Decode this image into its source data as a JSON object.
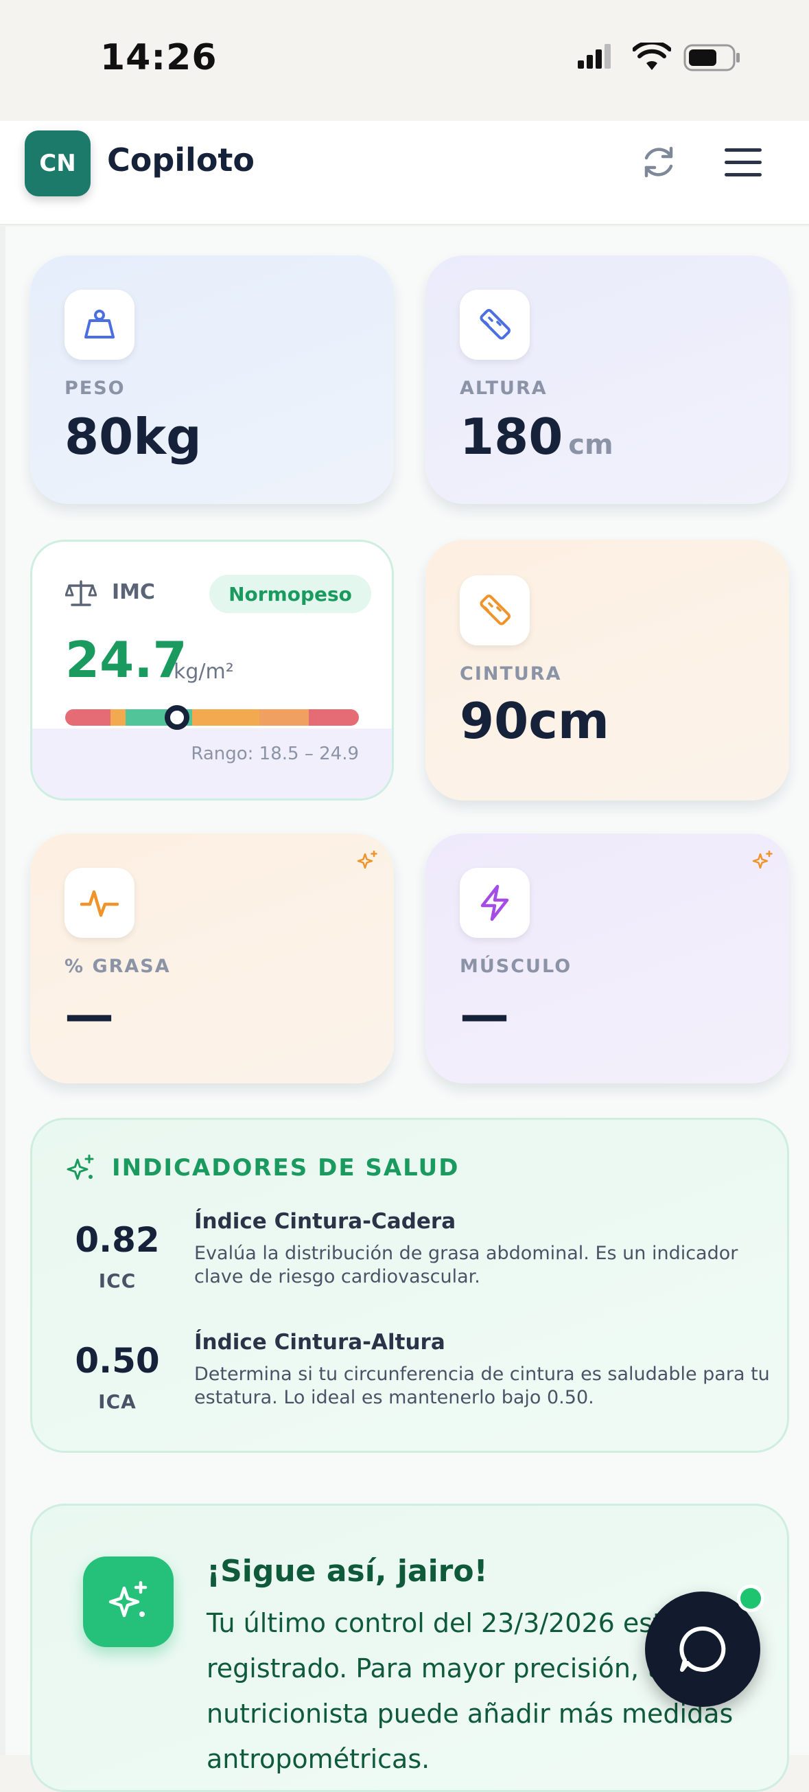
{
  "status_bar": {
    "time": "14:26"
  },
  "header": {
    "avatar_initials": "CN",
    "title": "Copiloto"
  },
  "metrics": {
    "peso": {
      "label": "PESO",
      "value": "80kg"
    },
    "altura": {
      "label": "ALTURA",
      "value": "180",
      "unit": "cm"
    },
    "imc": {
      "label": "IMC",
      "badge": "Normopeso",
      "value": "24.7",
      "unit": "kg/m²",
      "range": "Rango: 18.5 – 24.9",
      "marker_fraction": 0.38
    },
    "cintura": {
      "label": "CINTURA",
      "value": "90cm"
    },
    "grasa": {
      "label": "% GRASA",
      "value": "—"
    },
    "musculo": {
      "label": "MÚSCULO",
      "value": "—"
    }
  },
  "health": {
    "title": "INDICADORES DE SALUD",
    "items": [
      {
        "value": "0.82",
        "abbr": "ICC",
        "name": "Índice Cintura-Cadera",
        "desc": "Evalúa la distribución de grasa abdominal. Es un indicador clave de riesgo cardiovascular."
      },
      {
        "value": "0.50",
        "abbr": "ICA",
        "name": "Índice Cintura-Altura",
        "desc": "Determina si tu circunferencia de cintura es saludable para tu estatura. Lo ideal es mantenerlo bajo 0.50."
      }
    ]
  },
  "motivation": {
    "title": "¡Sigue así, jairo!",
    "text": "Tu último control del 23/3/2026 está registrado. Para mayor precisión, tu nutricionista puede añadir más medidas antropométricas."
  },
  "colors": {
    "accent_green": "#1a9a5e",
    "dark": "#16213a",
    "bar_red": "#e56b74",
    "bar_orange": "#f2a94f",
    "bar_green": "#52c49a"
  }
}
